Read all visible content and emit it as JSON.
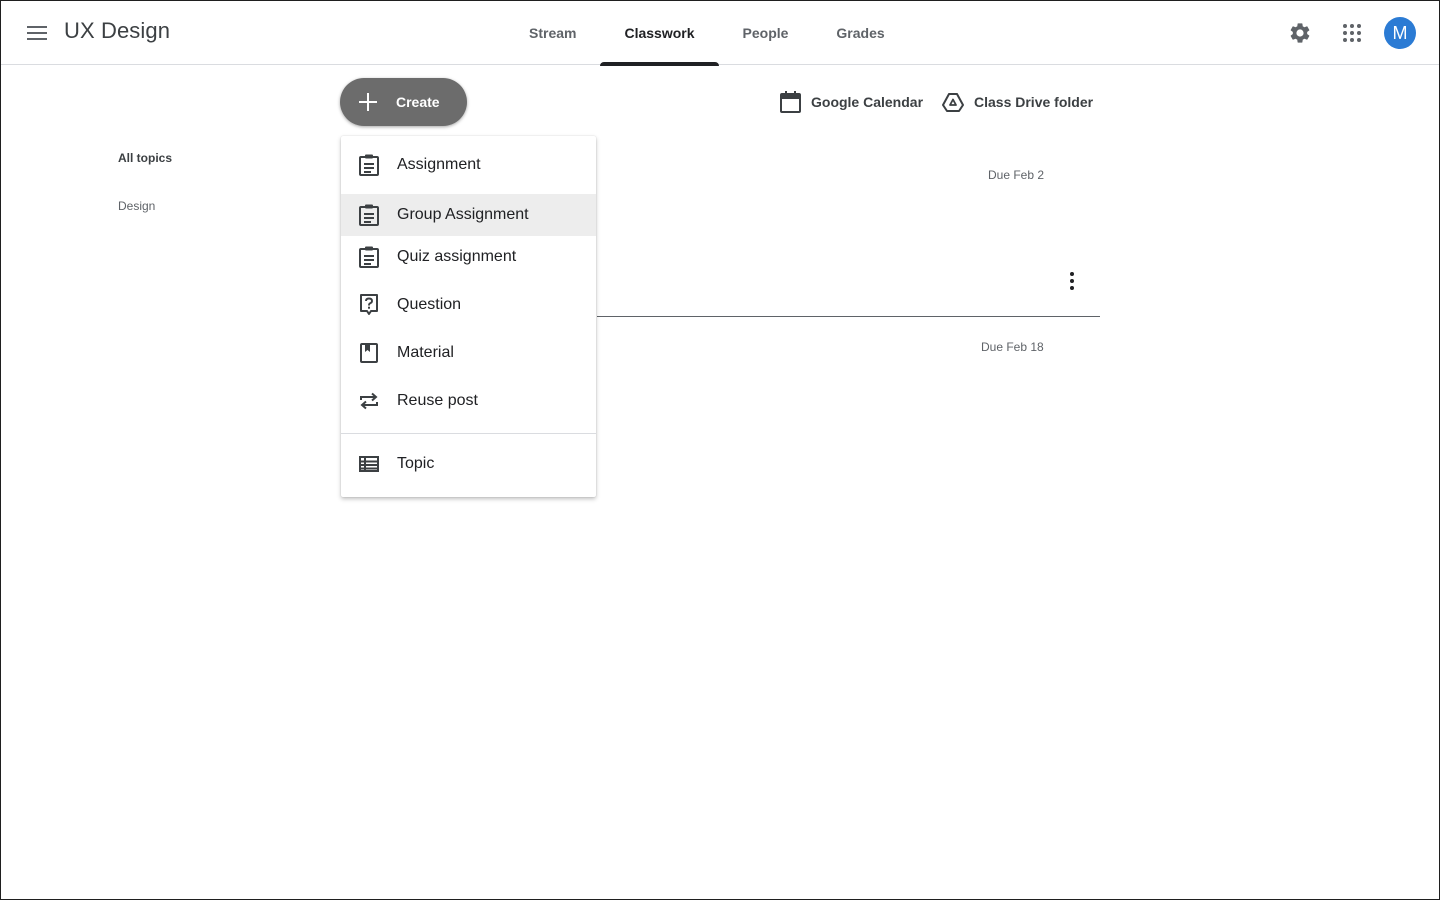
{
  "header": {
    "title": "UX Design",
    "tabs": [
      {
        "label": "Stream"
      },
      {
        "label": "Classwork"
      },
      {
        "label": "People"
      },
      {
        "label": "Grades"
      }
    ],
    "active_tab": "Classwork",
    "avatar_initial": "M",
    "icons": [
      "menu-icon",
      "gear-icon",
      "apps-grid-icon"
    ]
  },
  "toolbar": {
    "create_label": "Create",
    "calendar_label": "Google Calendar",
    "drive_label": "Class Drive folder"
  },
  "topics": {
    "items": [
      {
        "label": "All topics",
        "active": true
      },
      {
        "label": "Design",
        "active": false
      }
    ]
  },
  "classwork": {
    "items": [
      {
        "due": "Due Feb 2"
      },
      {
        "due": "Due Feb 18"
      }
    ]
  },
  "create_menu": {
    "items": [
      {
        "label": "Assignment",
        "icon": "assignment-icon"
      },
      {
        "label": "Group Assignment",
        "icon": "assignment-icon",
        "hovered": true
      },
      {
        "label": "Quiz assignment",
        "icon": "assignment-icon"
      },
      {
        "label": "Question",
        "icon": "question-icon"
      },
      {
        "label": "Material",
        "icon": "material-icon"
      },
      {
        "label": "Reuse post",
        "icon": "repeat-icon"
      },
      {
        "label": "Topic",
        "icon": "topic-icon"
      }
    ]
  },
  "colors": {
    "accent": "#202124",
    "create_button": "#6c6c6c",
    "avatar": "#2b7bd4",
    "menu_hover": "#ededed"
  }
}
